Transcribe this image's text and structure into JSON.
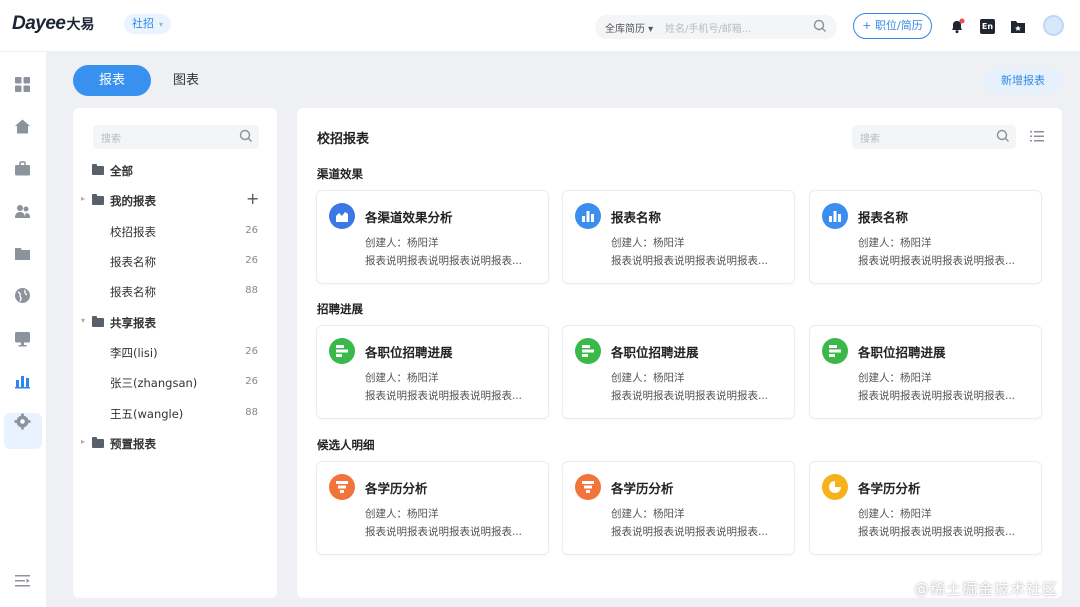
{
  "header": {
    "logo": "Dayee",
    "logo_cn": "大易",
    "campus_tag": "社招",
    "search_scope": "全库简历",
    "search_placeholder": "姓名/手机号/邮箱...",
    "add_button": "+ 职位/简历",
    "lang_label": "En"
  },
  "tabs": {
    "reports": "报表",
    "charts": "图表"
  },
  "new_report_button": "新增报表",
  "left": {
    "search_placeholder": "搜索",
    "all": "全部",
    "mine": {
      "label": "我的报表",
      "plus": "+",
      "items": [
        {
          "label": "校招报表",
          "count": "26"
        },
        {
          "label": "报表名称",
          "count": "26"
        },
        {
          "label": "报表名称",
          "count": "88"
        }
      ]
    },
    "shared": {
      "label": "共享报表",
      "items": [
        {
          "label": "李四(lisi)",
          "count": "26"
        },
        {
          "label": "张三(zhangsan)",
          "count": "26"
        },
        {
          "label": "王五(wangle)",
          "count": "88"
        }
      ]
    },
    "preset": "预置报表"
  },
  "main": {
    "title": "校招报表",
    "search_placeholder": "搜索",
    "sections": [
      {
        "title": "渠道效果",
        "cards": [
          {
            "title": "各渠道效果分析",
            "creator": "创建人：杨阳洋",
            "desc": "报表说明报表说明报表说明报表...",
            "icon": "area-chart-icon",
            "color": "#3a78e6"
          },
          {
            "title": "报表名称",
            "creator": "创建人：杨阳洋",
            "desc": "报表说明报表说明报表说明报表...",
            "icon": "bar-chart-icon",
            "color": "#3b8ef0"
          },
          {
            "title": "报表名称",
            "creator": "创建人：杨阳洋",
            "desc": "报表说明报表说明报表说明报表...",
            "icon": "bar-chart-icon",
            "color": "#3b8ef0"
          }
        ]
      },
      {
        "title": "招聘进展",
        "cards": [
          {
            "title": "各职位招聘进展",
            "creator": "创建人：杨阳洋",
            "desc": "报表说明报表说明报表说明报表...",
            "icon": "gantt-chart-icon",
            "color": "#3bb84a"
          },
          {
            "title": "各职位招聘进展",
            "creator": "创建人：杨阳洋",
            "desc": "报表说明报表说明报表说明报表...",
            "icon": "gantt-chart-icon",
            "color": "#3bb84a"
          },
          {
            "title": "各职位招聘进展",
            "creator": "创建人：杨阳洋",
            "desc": "报表说明报表说明报表说明报表...",
            "icon": "gantt-chart-icon",
            "color": "#3bb84a"
          }
        ]
      },
      {
        "title": "候选人明细",
        "cards": [
          {
            "title": "各学历分析",
            "creator": "创建人：杨阳洋",
            "desc": "报表说明报表说明报表说明报表...",
            "icon": "funnel-chart-icon",
            "color": "#f1743a"
          },
          {
            "title": "各学历分析",
            "creator": "创建人：杨阳洋",
            "desc": "报表说明报表说明报表说明报表...",
            "icon": "funnel-chart-icon",
            "color": "#f1743a"
          },
          {
            "title": "各学历分析",
            "creator": "创建人：杨阳洋",
            "desc": "报表说明报表说明报表说明报表...",
            "icon": "pie-chart-icon",
            "color": "#f5b21a"
          }
        ]
      }
    ]
  },
  "watermark": "@稀土掘金技术社区"
}
